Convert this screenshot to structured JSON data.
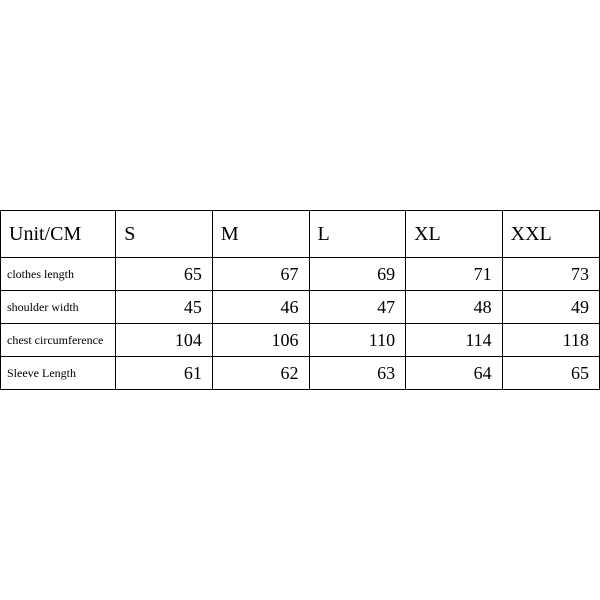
{
  "chart_data": {
    "type": "table",
    "title": "",
    "columns": [
      "Unit/CM",
      "S",
      "M",
      "L",
      "XL",
      "XXL"
    ],
    "rows": [
      {
        "label": "clothes length",
        "values": [
          65,
          67,
          69,
          71,
          73
        ]
      },
      {
        "label": "shoulder width",
        "values": [
          45,
          46,
          47,
          48,
          49
        ]
      },
      {
        "label": "chest circumference",
        "values": [
          104,
          106,
          110,
          114,
          118
        ]
      },
      {
        "label": "Sleeve Length",
        "values": [
          61,
          62,
          63,
          64,
          65
        ]
      }
    ]
  }
}
